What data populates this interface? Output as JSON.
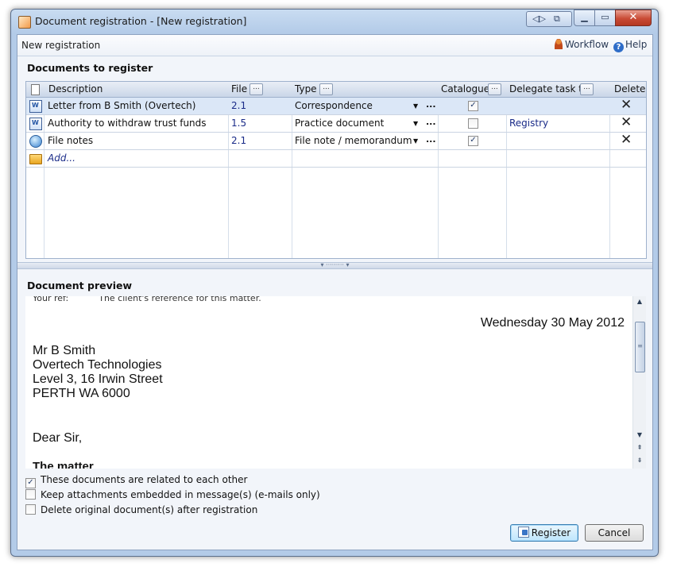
{
  "window": {
    "title": "Document registration - [New registration]",
    "close_glyph": "✕",
    "min_glyph": "▁",
    "max_glyph": "▭"
  },
  "toolbar": {
    "label": "New registration",
    "workflow": "Workflow",
    "help": "Help"
  },
  "documents": {
    "title": "Documents to register",
    "columns": {
      "description": "Description",
      "file": "File",
      "type": "Type",
      "catalogue": "Catalogue",
      "delegate": "Delegate task to",
      "delete": "Delete",
      "ellipsis": "..."
    },
    "rows": [
      {
        "description": "Letter from B Smith (Overtech)",
        "file": "2.1",
        "type": "Correspondence",
        "catalogue": true,
        "delegate": "",
        "icon": "word-document-icon"
      },
      {
        "description": "Authority to withdraw trust funds",
        "file": "1.5",
        "type": "Practice document",
        "catalogue": false,
        "delegate": "Registry",
        "icon": "word-document-icon"
      },
      {
        "description": "File notes",
        "file": "2.1",
        "type": "File note / memorandum",
        "catalogue": true,
        "delegate": "",
        "icon": "note-icon"
      }
    ],
    "add_label": "Add...",
    "delete_glyph": "✕",
    "dropdown_glyph": "▼",
    "dots": "..."
  },
  "preview": {
    "title": "Document preview",
    "ref_label": "Your ref:",
    "ref_value": "The client's reference for this matter.",
    "date": "Wednesday 30 May 2012",
    "address": [
      "Mr B Smith",
      "Overtech Technologies",
      "Level 3, 16 Irwin Street",
      "PERTH WA 6000"
    ],
    "greeting": "Dear Sir,",
    "heading": "The matter"
  },
  "options": [
    {
      "label": "These documents are related to each other",
      "checked": true
    },
    {
      "label": "Keep attachments embedded in message(s) (e-mails only)",
      "checked": false
    },
    {
      "label": "Delete original document(s) after registration",
      "checked": false
    }
  ],
  "buttons": {
    "register": "Register",
    "cancel": "Cancel"
  }
}
